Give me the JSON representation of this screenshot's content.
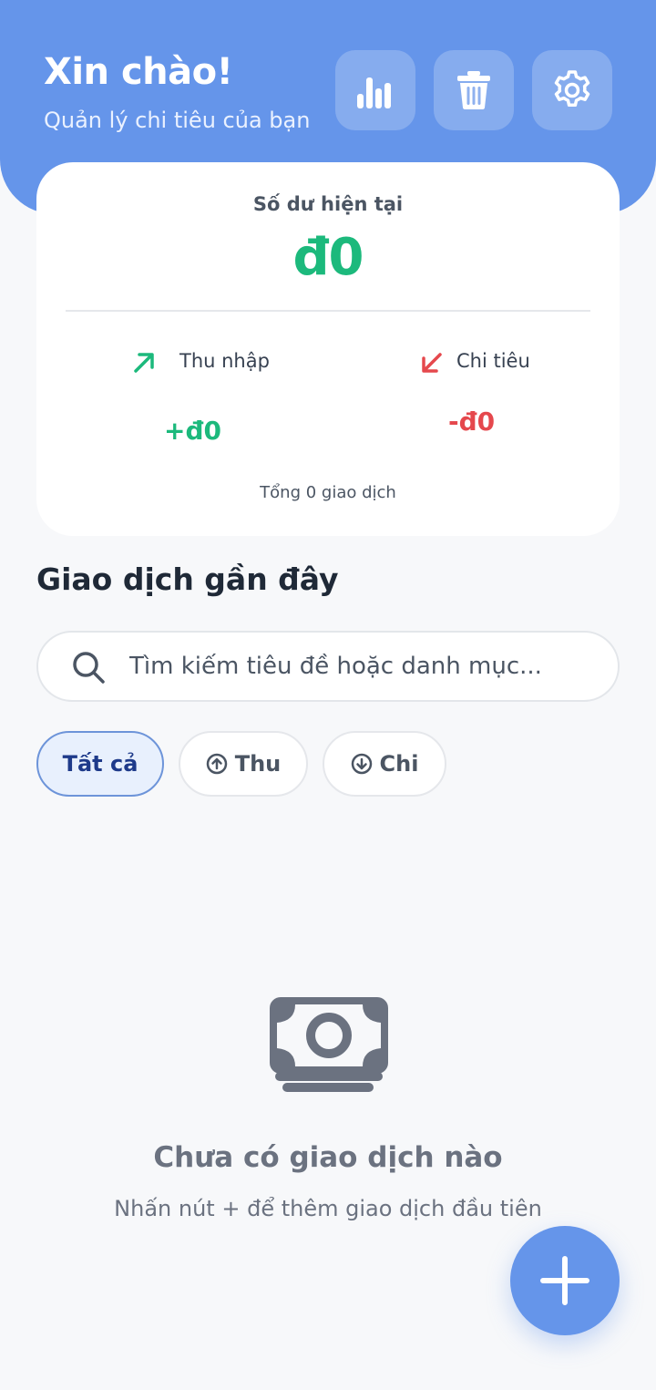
{
  "header": {
    "greeting": "Xin chào!",
    "subtitle": "Quản lý chi tiêu của bạn",
    "buttons": [
      "stats",
      "delete",
      "settings"
    ]
  },
  "balance": {
    "label": "Số dư hiện tại",
    "value": "đ0",
    "income_label": "Thu nhập",
    "income_value": "+đ0",
    "expense_label": "Chi tiêu",
    "expense_value": "-đ0",
    "total": "Tổng 0 giao dịch"
  },
  "transactions": {
    "title": "Giao dịch gần đây",
    "search_placeholder": "Tìm kiếm tiêu đề hoặc danh mục...",
    "filters": {
      "all": "Tất cả",
      "income": "Thu",
      "expense": "Chi",
      "selected": "all"
    },
    "empty_title": "Chưa có giao dịch nào",
    "empty_subtitle": "Nhấn nút + để thêm giao dịch đầu tiên"
  },
  "colors": {
    "primary": "#6595ea",
    "income": "#1cb97c",
    "expense": "#e5484d"
  }
}
